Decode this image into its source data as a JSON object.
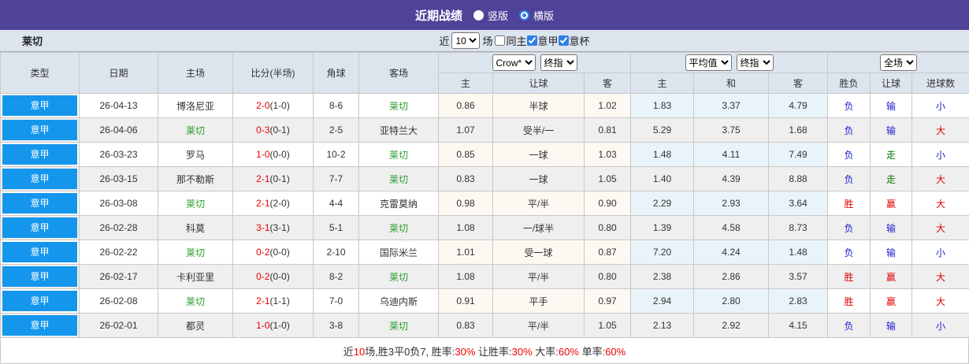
{
  "titlebar": {
    "title": "近期战绩",
    "options": [
      {
        "label": "竖版",
        "selected": false
      },
      {
        "label": "横版",
        "selected": true
      }
    ]
  },
  "filter": {
    "team": "莱切",
    "near_label": "近",
    "count_value": "10",
    "games_label": "场",
    "checks": [
      {
        "label": "同主",
        "checked": false
      },
      {
        "label": "意甲",
        "checked": true
      },
      {
        "label": "意杯",
        "checked": true
      }
    ]
  },
  "table": {
    "main_headers": [
      "类型",
      "日期",
      "主场",
      "比分(半场)",
      "角球",
      "客场"
    ],
    "groups": {
      "odds": {
        "selects": [
          "Crow*",
          "终指"
        ],
        "cols": [
          "主",
          "让球",
          "客"
        ]
      },
      "avg": {
        "selects": [
          "平均值",
          "终指"
        ],
        "cols": [
          "主",
          "和",
          "客"
        ]
      },
      "result": {
        "selects": [
          "全场"
        ],
        "cols": [
          "胜负",
          "让球",
          "进球数"
        ]
      }
    },
    "self_team": "莱切",
    "result_colors": {
      "胜": "#e10000",
      "负": "#2020cc",
      "赢": "#e10000",
      "输": "#2020cc",
      "走": "#0a7a0a",
      "大": "#e10000",
      "小": "#2020cc"
    },
    "rows": [
      {
        "league": "意甲",
        "date": "26-04-13",
        "home": "博洛尼亚",
        "ft": "2-0",
        "ht": "(1-0)",
        "corner": "8-6",
        "away": "莱切",
        "odds": [
          "0.86",
          "半球",
          "1.02"
        ],
        "avg": [
          "1.83",
          "3.37",
          "4.79"
        ],
        "results": [
          "负",
          "输",
          "小"
        ]
      },
      {
        "league": "意甲",
        "date": "26-04-06",
        "home": "莱切",
        "ft": "0-3",
        "ht": "(0-1)",
        "corner": "2-5",
        "away": "亚特兰大",
        "odds": [
          "1.07",
          "受半/一",
          "0.81"
        ],
        "avg": [
          "5.29",
          "3.75",
          "1.68"
        ],
        "results": [
          "负",
          "输",
          "大"
        ]
      },
      {
        "league": "意甲",
        "date": "26-03-23",
        "home": "罗马",
        "ft": "1-0",
        "ht": "(0-0)",
        "corner": "10-2",
        "away": "莱切",
        "odds": [
          "0.85",
          "一球",
          "1.03"
        ],
        "avg": [
          "1.48",
          "4.11",
          "7.49"
        ],
        "results": [
          "负",
          "走",
          "小"
        ]
      },
      {
        "league": "意甲",
        "date": "26-03-15",
        "home": "那不勒斯",
        "ft": "2-1",
        "ht": "(0-1)",
        "corner": "7-7",
        "away": "莱切",
        "odds": [
          "0.83",
          "一球",
          "1.05"
        ],
        "avg": [
          "1.40",
          "4.39",
          "8.88"
        ],
        "results": [
          "负",
          "走",
          "大"
        ]
      },
      {
        "league": "意甲",
        "date": "26-03-08",
        "home": "莱切",
        "ft": "2-1",
        "ht": "(2-0)",
        "corner": "4-4",
        "away": "克雷莫纳",
        "odds": [
          "0.98",
          "平/半",
          "0.90"
        ],
        "avg": [
          "2.29",
          "2.93",
          "3.64"
        ],
        "results": [
          "胜",
          "赢",
          "大"
        ]
      },
      {
        "league": "意甲",
        "date": "26-02-28",
        "home": "科莫",
        "ft": "3-1",
        "ht": "(3-1)",
        "corner": "5-1",
        "away": "莱切",
        "odds": [
          "1.08",
          "一/球半",
          "0.80"
        ],
        "avg": [
          "1.39",
          "4.58",
          "8.73"
        ],
        "results": [
          "负",
          "输",
          "大"
        ]
      },
      {
        "league": "意甲",
        "date": "26-02-22",
        "home": "莱切",
        "ft": "0-2",
        "ht": "(0-0)",
        "corner": "2-10",
        "away": "国际米兰",
        "odds": [
          "1.01",
          "受一球",
          "0.87"
        ],
        "avg": [
          "7.20",
          "4.24",
          "1.48"
        ],
        "results": [
          "负",
          "输",
          "小"
        ]
      },
      {
        "league": "意甲",
        "date": "26-02-17",
        "home": "卡利亚里",
        "ft": "0-2",
        "ht": "(0-0)",
        "corner": "8-2",
        "away": "莱切",
        "odds": [
          "1.08",
          "平/半",
          "0.80"
        ],
        "avg": [
          "2.38",
          "2.86",
          "3.57"
        ],
        "results": [
          "胜",
          "赢",
          "大"
        ]
      },
      {
        "league": "意甲",
        "date": "26-02-08",
        "home": "莱切",
        "ft": "2-1",
        "ht": "(1-1)",
        "corner": "7-0",
        "away": "乌迪内斯",
        "odds": [
          "0.91",
          "平手",
          "0.97"
        ],
        "avg": [
          "2.94",
          "2.80",
          "2.83"
        ],
        "results": [
          "胜",
          "赢",
          "大"
        ]
      },
      {
        "league": "意甲",
        "date": "26-02-01",
        "home": "都灵",
        "ft": "1-0",
        "ht": "(1-0)",
        "corner": "3-8",
        "away": "莱切",
        "odds": [
          "0.83",
          "平/半",
          "1.05"
        ],
        "avg": [
          "2.13",
          "2.92",
          "4.15"
        ],
        "results": [
          "负",
          "输",
          "小"
        ]
      }
    ]
  },
  "summary": {
    "segments": [
      {
        "text": "近",
        "red": false
      },
      {
        "text": "10",
        "red": true
      },
      {
        "text": "场,胜3平0负7, 胜率:",
        "red": false
      },
      {
        "text": "30%",
        "red": true
      },
      {
        "text": " 让胜率:",
        "red": false
      },
      {
        "text": "30%",
        "red": true
      },
      {
        "text": " 大率:",
        "red": false
      },
      {
        "text": "60%",
        "red": true
      },
      {
        "text": " 单率:",
        "red": false
      },
      {
        "text": "60%",
        "red": true
      }
    ]
  }
}
